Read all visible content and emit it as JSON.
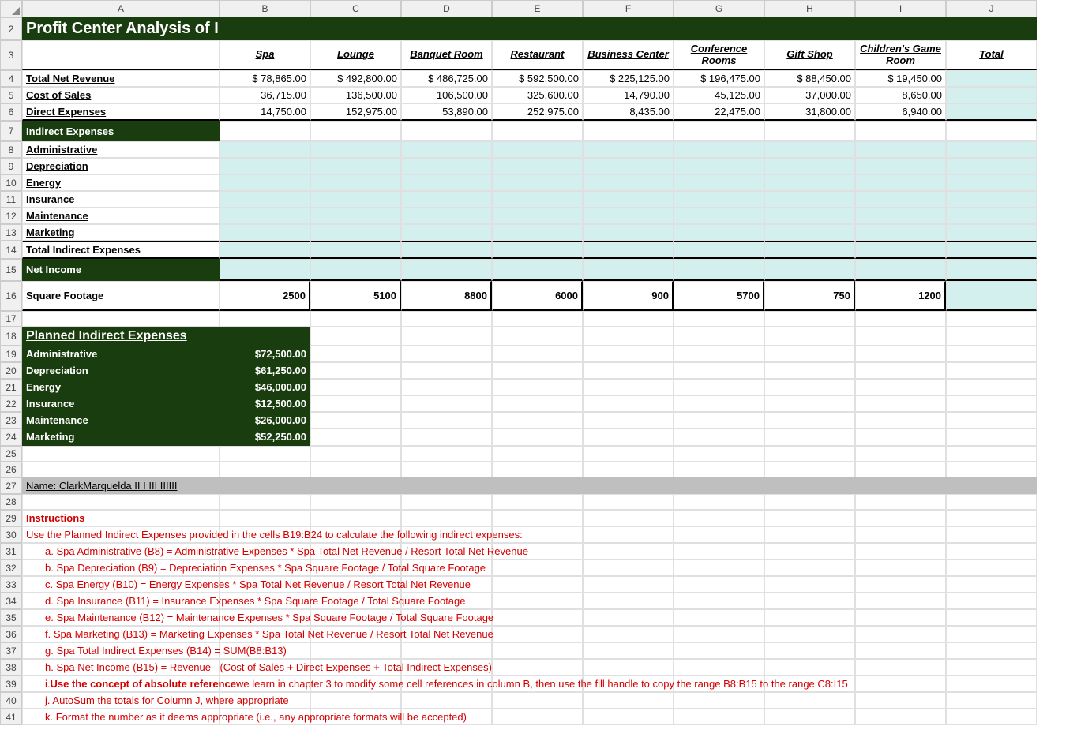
{
  "cols": [
    "A",
    "B",
    "C",
    "D",
    "E",
    "F",
    "G",
    "H",
    "I",
    "J"
  ],
  "title": "Profit Center Analysis of Indirect Expenses",
  "headers": [
    "",
    "Spa",
    "Lounge",
    "Banquet Room",
    "Restaurant",
    "Business Center",
    "Conference Rooms",
    "Gift Shop",
    "Children's Game Room",
    "Total"
  ],
  "rows_data": [
    {
      "n": 4,
      "label": "Total Net Revenue",
      "vals": [
        "$      78,865.00",
        "$    492,800.00",
        "$    486,725.00",
        "$    592,500.00",
        "$    225,125.00",
        "$    196,475.00",
        "$      88,450.00",
        "$      19,450.00",
        ""
      ],
      "cyanLast": true
    },
    {
      "n": 5,
      "label": "Cost of Sales",
      "vals": [
        "36,715.00",
        "136,500.00",
        "106,500.00",
        "325,600.00",
        "14,790.00",
        "45,125.00",
        "37,000.00",
        "8,650.00",
        ""
      ],
      "cyanLast": true
    },
    {
      "n": 6,
      "label": "Direct Expenses",
      "vals": [
        "14,750.00",
        "152,975.00",
        "53,890.00",
        "252,975.00",
        "8,435.00",
        "22,475.00",
        "31,800.00",
        "6,940.00",
        ""
      ],
      "cyanLast": true,
      "thickBottom": true
    }
  ],
  "section1": "Indirect Expenses",
  "indirect_rows": [
    {
      "n": 8,
      "label": "Administrative"
    },
    {
      "n": 9,
      "label": "Depreciation"
    },
    {
      "n": 10,
      "label": "Energy"
    },
    {
      "n": 11,
      "label": "Insurance"
    },
    {
      "n": 12,
      "label": "Maintenance"
    },
    {
      "n": 13,
      "label": "Marketing"
    }
  ],
  "row14_label": "Total Indirect Expenses",
  "section2": "Net Income",
  "row16_label": "Square Footage",
  "row16_vals": [
    "2500",
    "5100",
    "8800",
    "6000",
    "900",
    "5700",
    "750",
    "1200",
    ""
  ],
  "planned_title": "Planned Indirect Expenses",
  "planned": [
    {
      "n": 19,
      "label": "Administrative",
      "val": "$72,500.00"
    },
    {
      "n": 20,
      "label": "Depreciation",
      "val": "$61,250.00"
    },
    {
      "n": 21,
      "label": "Energy",
      "val": "$46,000.00"
    },
    {
      "n": 22,
      "label": "Insurance",
      "val": "$12,500.00"
    },
    {
      "n": 23,
      "label": "Maintenance",
      "val": "$26,000.00"
    },
    {
      "n": 24,
      "label": "Marketing",
      "val": "$52,250.00"
    }
  ],
  "name_row": "Name:  ClarkMarquelda  II  I III    IIIIII",
  "instructions_label": "Instructions",
  "instructions": [
    {
      "n": 30,
      "indent": false,
      "bold": false,
      "text": "Use the Planned Indirect Expenses provided in the cells B19:B24 to calculate the following indirect expenses:"
    },
    {
      "n": 31,
      "indent": true,
      "bold": false,
      "text": "a. Spa Administrative (B8) = Administrative Expenses * Spa Total Net Revenue / Resort Total Net Revenue"
    },
    {
      "n": 32,
      "indent": true,
      "bold": false,
      "text": "b. Spa Depreciation (B9) = Depreciation Expenses * Spa Square Footage / Total Square Footage"
    },
    {
      "n": 33,
      "indent": true,
      "bold": false,
      "text": "c. Spa Energy (B10) = Energy Expenses * Spa Total Net Revenue / Resort Total Net Revenue"
    },
    {
      "n": 34,
      "indent": true,
      "bold": false,
      "text": "d. Spa Insurance (B11) = Insurance Expenses * Spa Square Footage / Total Square Footage"
    },
    {
      "n": 35,
      "indent": true,
      "bold": false,
      "text": "e. Spa Maintenance (B12) = Maintenance Expenses * Spa Square Footage / Total Square Footage"
    },
    {
      "n": 36,
      "indent": true,
      "bold": false,
      "text": "f.  Spa Marketing (B13) = Marketing Expenses * Spa Total Net Revenue / Resort Total Net Revenue"
    },
    {
      "n": 37,
      "indent": true,
      "bold": false,
      "text": "g. Spa Total Indirect Expenses (B14) = SUM(B8:B13)"
    },
    {
      "n": 38,
      "indent": true,
      "bold": false,
      "text": "h. Spa Net Income (B15) = Revenue -  (Cost of Sales + Direct Expenses + Total Indirect Expenses)"
    },
    {
      "n": 39,
      "indent": true,
      "bold": false,
      "pre": "i. ",
      "boldpart": "Use the concept of absolute reference",
      "post": " we learn in chapter 3 to modify some cell references in column B, then use the fill handle to copy the range B8:B15 to the range C8:I15"
    },
    {
      "n": 40,
      "indent": true,
      "bold": false,
      "text": "j. AutoSum the totals for Column J, where appropriate"
    },
    {
      "n": 41,
      "indent": true,
      "bold": false,
      "text": "k. Format the number as it deems appropriate (i.e., any appropriate formats will be accepted)"
    }
  ]
}
